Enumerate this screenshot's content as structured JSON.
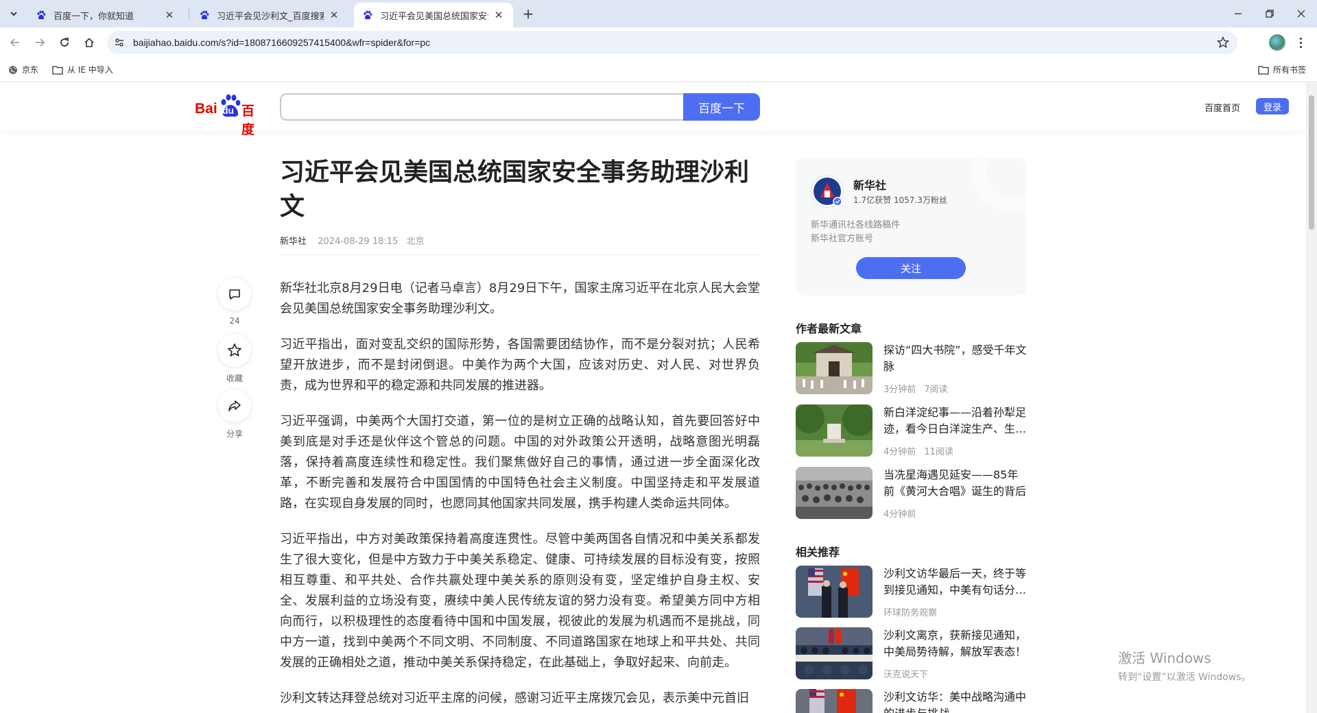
{
  "browser": {
    "tabs": [
      {
        "title": "百度一下，你就知道",
        "active": false
      },
      {
        "title": "习近平会见沙利文_百度搜索",
        "active": false
      },
      {
        "title": "习近平会见美国总统国家安全事务助理沙利文",
        "active": true
      }
    ],
    "url": "baijiahao.baidu.com/s?id=1808716609257415400&wfr=spider&for=pc",
    "bookmarks": [
      {
        "label": "京东"
      },
      {
        "label": "从 IE 中导入"
      }
    ],
    "all_bookmarks_label": "所有书签"
  },
  "header": {
    "logo_text_left": "Bai",
    "logo_text_du": "du",
    "logo_text_right": "百度",
    "search_placeholder": "",
    "search_button": "百度一下",
    "home_link": "百度首页",
    "login": "登录"
  },
  "article": {
    "title": "习近平会见美国总统国家安全事务助理沙利文",
    "author": "新华社",
    "datetime": "2024-08-29 18:15",
    "location": "北京",
    "paragraphs": [
      "新华社北京8月29日电（记者马卓言）8月29日下午，国家主席习近平在北京人民大会堂会见美国总统国家安全事务助理沙利文。",
      "习近平指出，面对变乱交织的国际形势，各国需要团结协作，而不是分裂对抗；人民希望开放进步，而不是封闭倒退。中美作为两个大国，应该对历史、对人民、对世界负责，成为世界和平的稳定源和共同发展的推进器。",
      "习近平强调，中美两个大国打交道，第一位的是树立正确的战略认知，首先要回答好中美到底是对手还是伙伴这个管总的问题。中国的对外政策公开透明，战略意图光明磊落，保持着高度连续性和稳定性。我们聚焦做好自己的事情，通过进一步全面深化改革，不断完善和发展符合中国国情的中国特色社会主义制度。中国坚持走和平发展道路，在实现自身发展的同时，也愿同其他国家共同发展，携手构建人类命运共同体。",
      "习近平指出，中方对美政策保持着高度连贯性。尽管中美两国各自情况和中美关系都发生了很大变化，但是中方致力于中美关系稳定、健康、可持续发展的目标没有变，按照相互尊重、和平共处、合作共赢处理中美关系的原则没有变，坚定维护自身主权、安全、发展利益的立场没有变，赓续中美人民传统友谊的努力没有变。希望美方同中方相向而行，以积极理性的态度看待中国和中国发展，视彼此的发展为机遇而不是挑战，同中方一道，找到中美两个不同文明、不同制度、不同道路国家在地球上和平共处、共同发展的正确相处之道，推动中美关系保持稳定，在此基础上，争取好起来、向前走。",
      "沙利文转达拜登总统对习近平主席的问候，感谢习近平主席拨冗会见，表示美中元首旧"
    ]
  },
  "actions": {
    "comment_count": "24",
    "favorite_label": "收藏",
    "share_label": "分享"
  },
  "author_card": {
    "name": "新华社",
    "stats": "1.7亿获赞 1057.3万粉丝",
    "desc_line1": "新华通讯社各线路稿件",
    "desc_line2": "新华社官方账号",
    "follow": "关注"
  },
  "latest": {
    "title": "作者最新文章",
    "items": [
      {
        "title": "探访“四大书院”，感受千年文脉",
        "time": "3分钟前",
        "reads": "7阅读"
      },
      {
        "title": "新白洋淀纪事——沿着孙犁足迹，看今日白洋淀生产、生…",
        "time": "4分钟前",
        "reads": "11阅读"
      },
      {
        "title": "当冼星海遇见延安——85年前《黄河大合唱》诞生的背后",
        "time": "4分钟前",
        "reads": ""
      }
    ]
  },
  "related": {
    "title": "相关推荐",
    "items": [
      {
        "title": "沙利文访华最后一天，终于等到接见通知，中美有句话分…",
        "source": "环球防务观察"
      },
      {
        "title": "沙利文离京，获新接见通知，中美局势待解，解放军表态！",
        "source": "沃克说天下"
      },
      {
        "title": "沙利文访华：美中战略沟通中的进步与挑战",
        "source": ""
      }
    ]
  },
  "watermark": {
    "line1": "激活 Windows",
    "line2": "转到“设置”以激活 Windows。"
  },
  "colors": {
    "accent": "#4e6ef2",
    "tabstrip": "#dfe6f3",
    "logo_red": "#e10602",
    "logo_blue": "#2932e1"
  }
}
